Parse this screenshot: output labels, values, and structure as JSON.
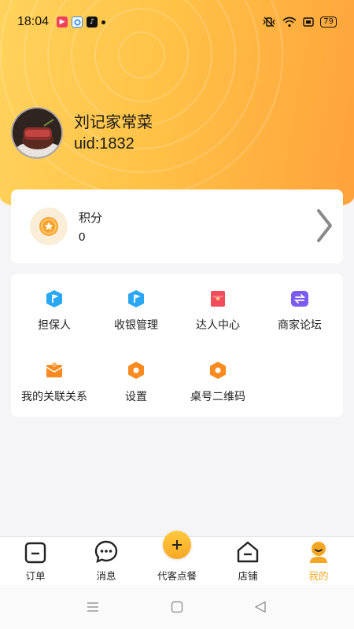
{
  "status_bar": {
    "time": "18:04",
    "battery": "79"
  },
  "profile": {
    "name": "刘记家常菜",
    "uid": "uid:1832"
  },
  "points": {
    "label": "积分",
    "value": "0"
  },
  "menu": {
    "items": [
      {
        "label": "担保人",
        "icon": "shield-flag-icon",
        "color": "#2aa7f3"
      },
      {
        "label": "收银管理",
        "icon": "shield-flag-icon",
        "color": "#2aa7f3"
      },
      {
        "label": "达人中心",
        "icon": "red-envelope-icon",
        "color": "#f24b5b"
      },
      {
        "label": "商家论坛",
        "icon": "exchange-icon",
        "color": "#7b5cf0"
      },
      {
        "label": "我的关联关系",
        "icon": "mail-icon",
        "color": "#f98a1f"
      },
      {
        "label": "设置",
        "icon": "hexagon-icon",
        "color": "#f98a1f"
      },
      {
        "label": "桌号二维码",
        "icon": "hexagon-icon",
        "color": "#f98a1f"
      }
    ]
  },
  "tabbar": {
    "tabs": [
      {
        "label": "订单",
        "icon": "order-icon"
      },
      {
        "label": "消息",
        "icon": "message-icon"
      },
      {
        "label": "代客点餐",
        "icon": "plus-icon"
      },
      {
        "label": "店铺",
        "icon": "shop-icon"
      },
      {
        "label": "我的",
        "icon": "profile-icon"
      }
    ],
    "active_color": "#f5a623"
  },
  "colors": {
    "header_gradient_start": "#ffd35c",
    "header_gradient_end": "#ffa23b",
    "accent": "#f5a623"
  }
}
